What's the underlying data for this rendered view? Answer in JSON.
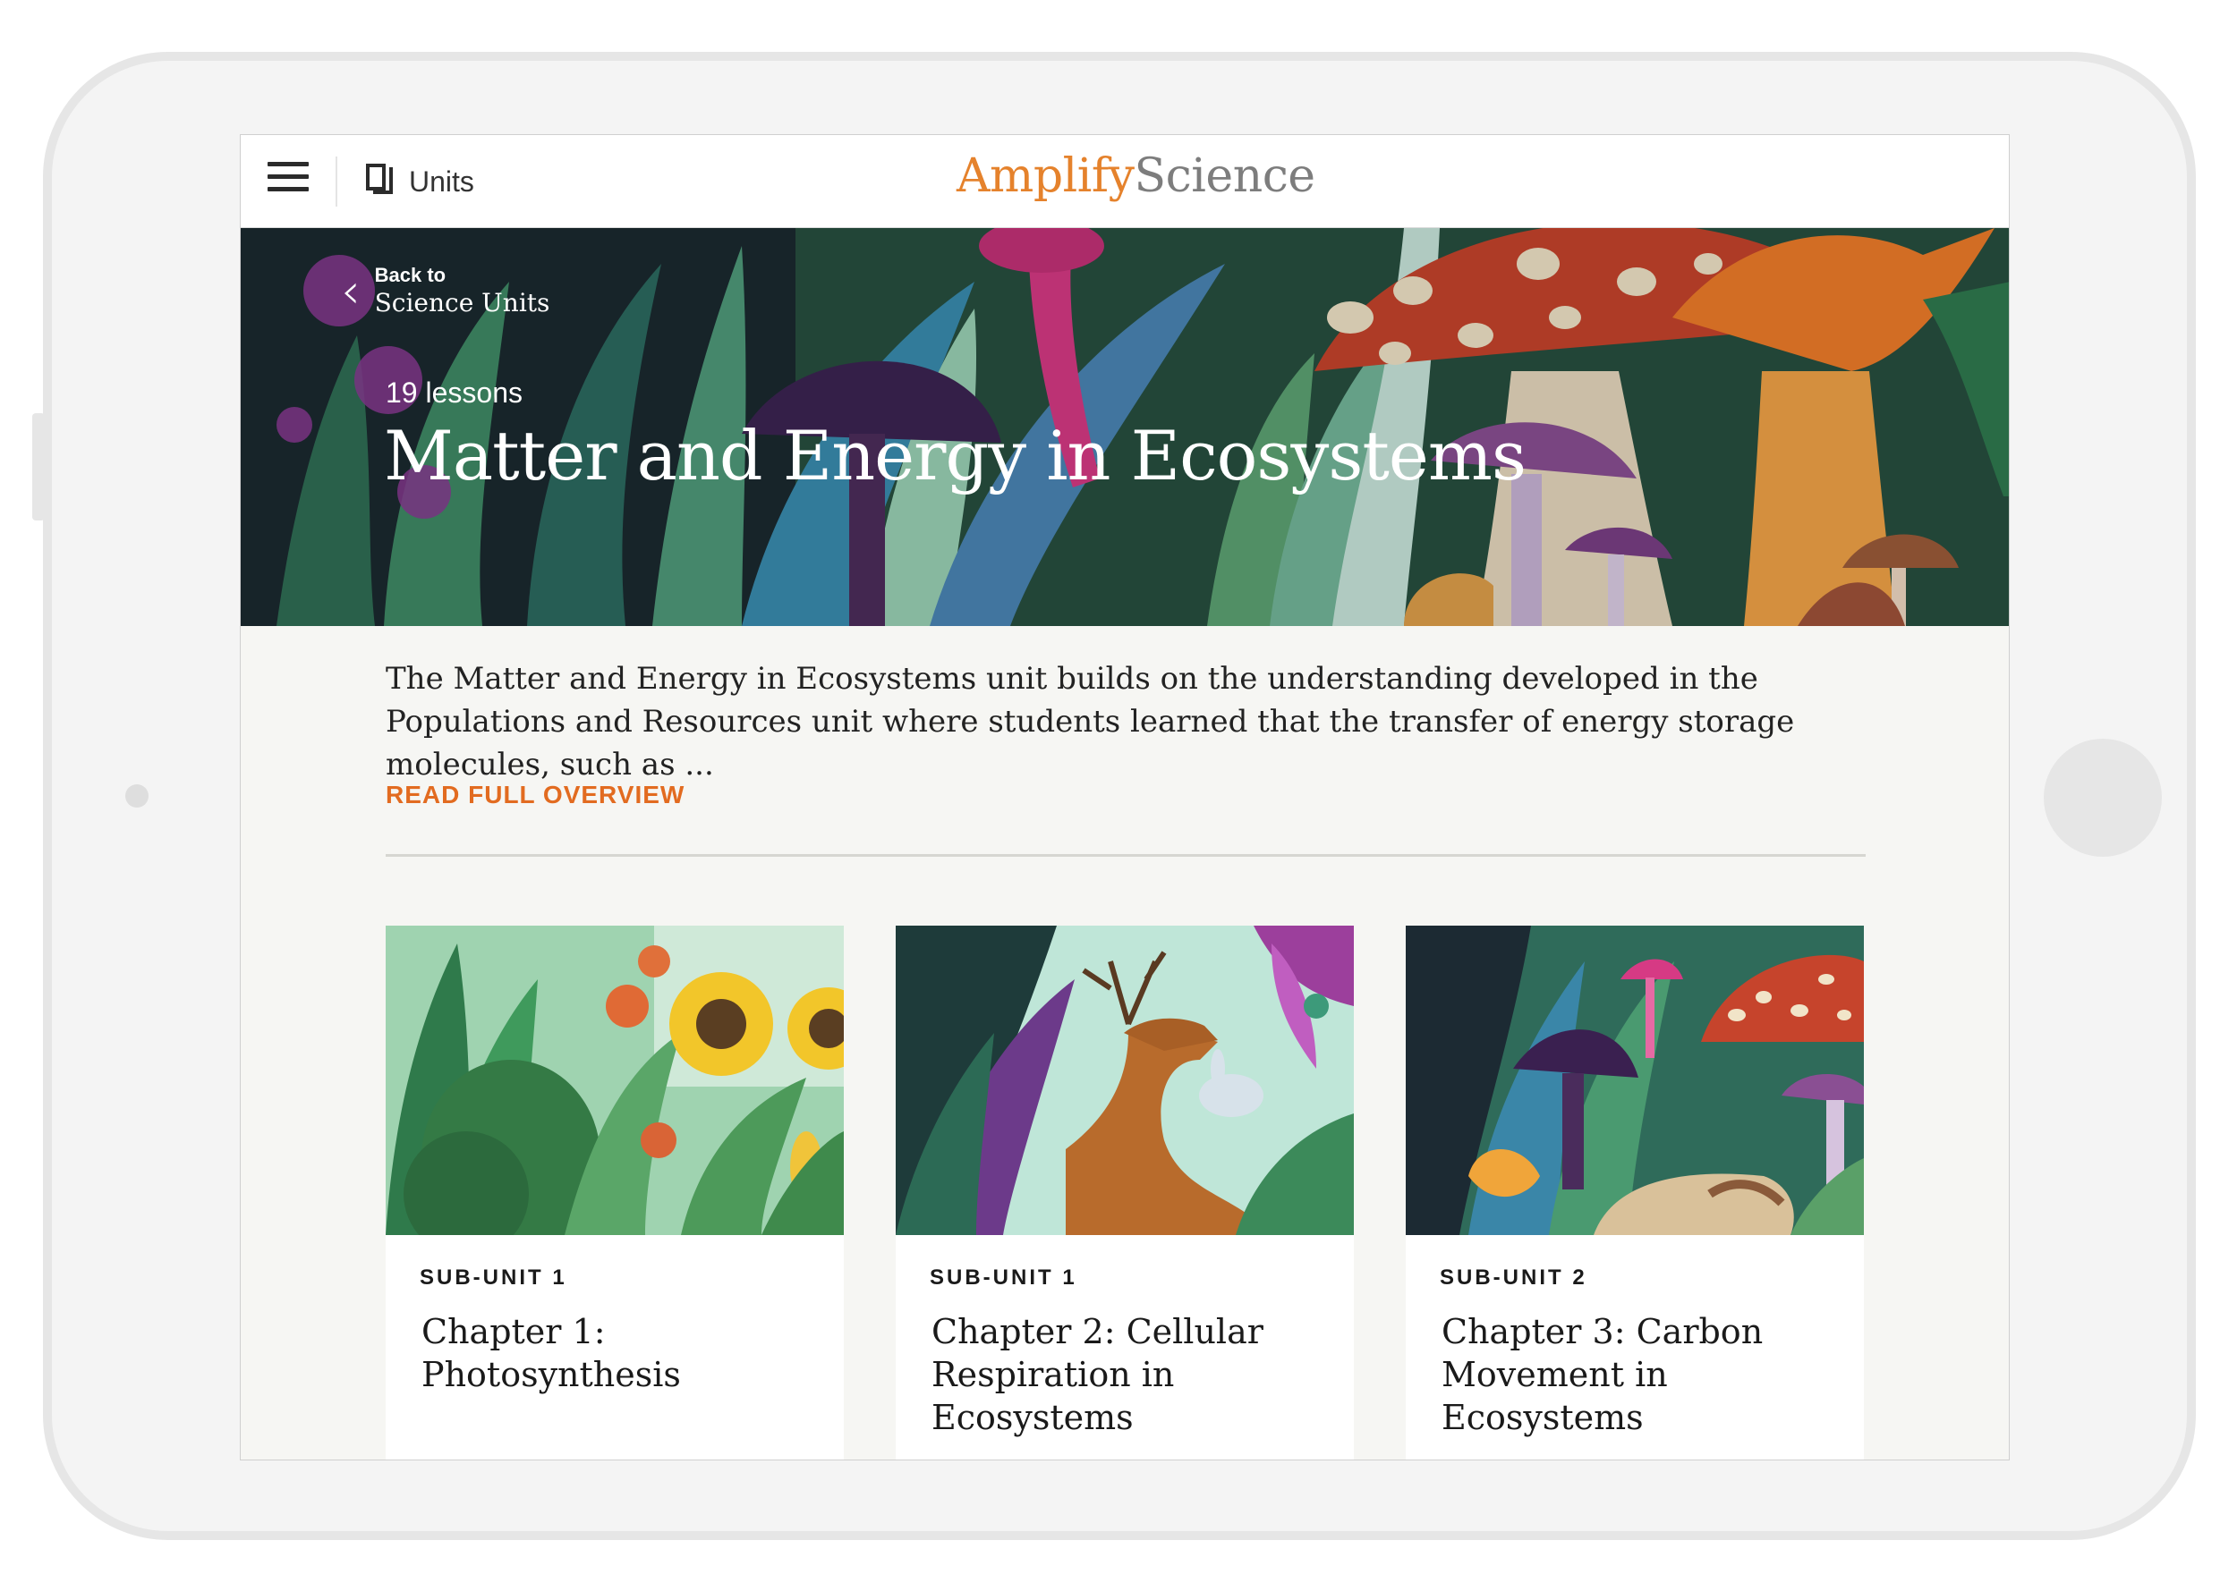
{
  "header": {
    "units_label": "Units",
    "logo_amplify": "Amplify",
    "logo_science": "Science"
  },
  "hero": {
    "back_small": "Back to",
    "back_big": "Science Units",
    "lessons": "19 lessons",
    "title": "Matter and Energy in Ecosystems"
  },
  "overview": {
    "text": "The Matter and Energy in Ecosystems unit builds on the understanding developed in the Populations and Resources unit where students learned that the transfer of energy storage molecules, such as ...",
    "read_full": "READ FULL OVERVIEW"
  },
  "cards": [
    {
      "subunit": "SUB-UNIT 1",
      "chapter": "Chapter 1: Photosynthesis"
    },
    {
      "subunit": "SUB-UNIT 1",
      "chapter": "Chapter 2: Cellular Respiration in Ecosystems"
    },
    {
      "subunit": "SUB-UNIT 2",
      "chapter": "Chapter 3: Carbon Movement in Ecosystems"
    }
  ],
  "colors": {
    "accent": "#e26b20",
    "logo_orange": "#e5822c",
    "logo_gray": "#7d7d7d",
    "background": "#f6f6f3"
  }
}
